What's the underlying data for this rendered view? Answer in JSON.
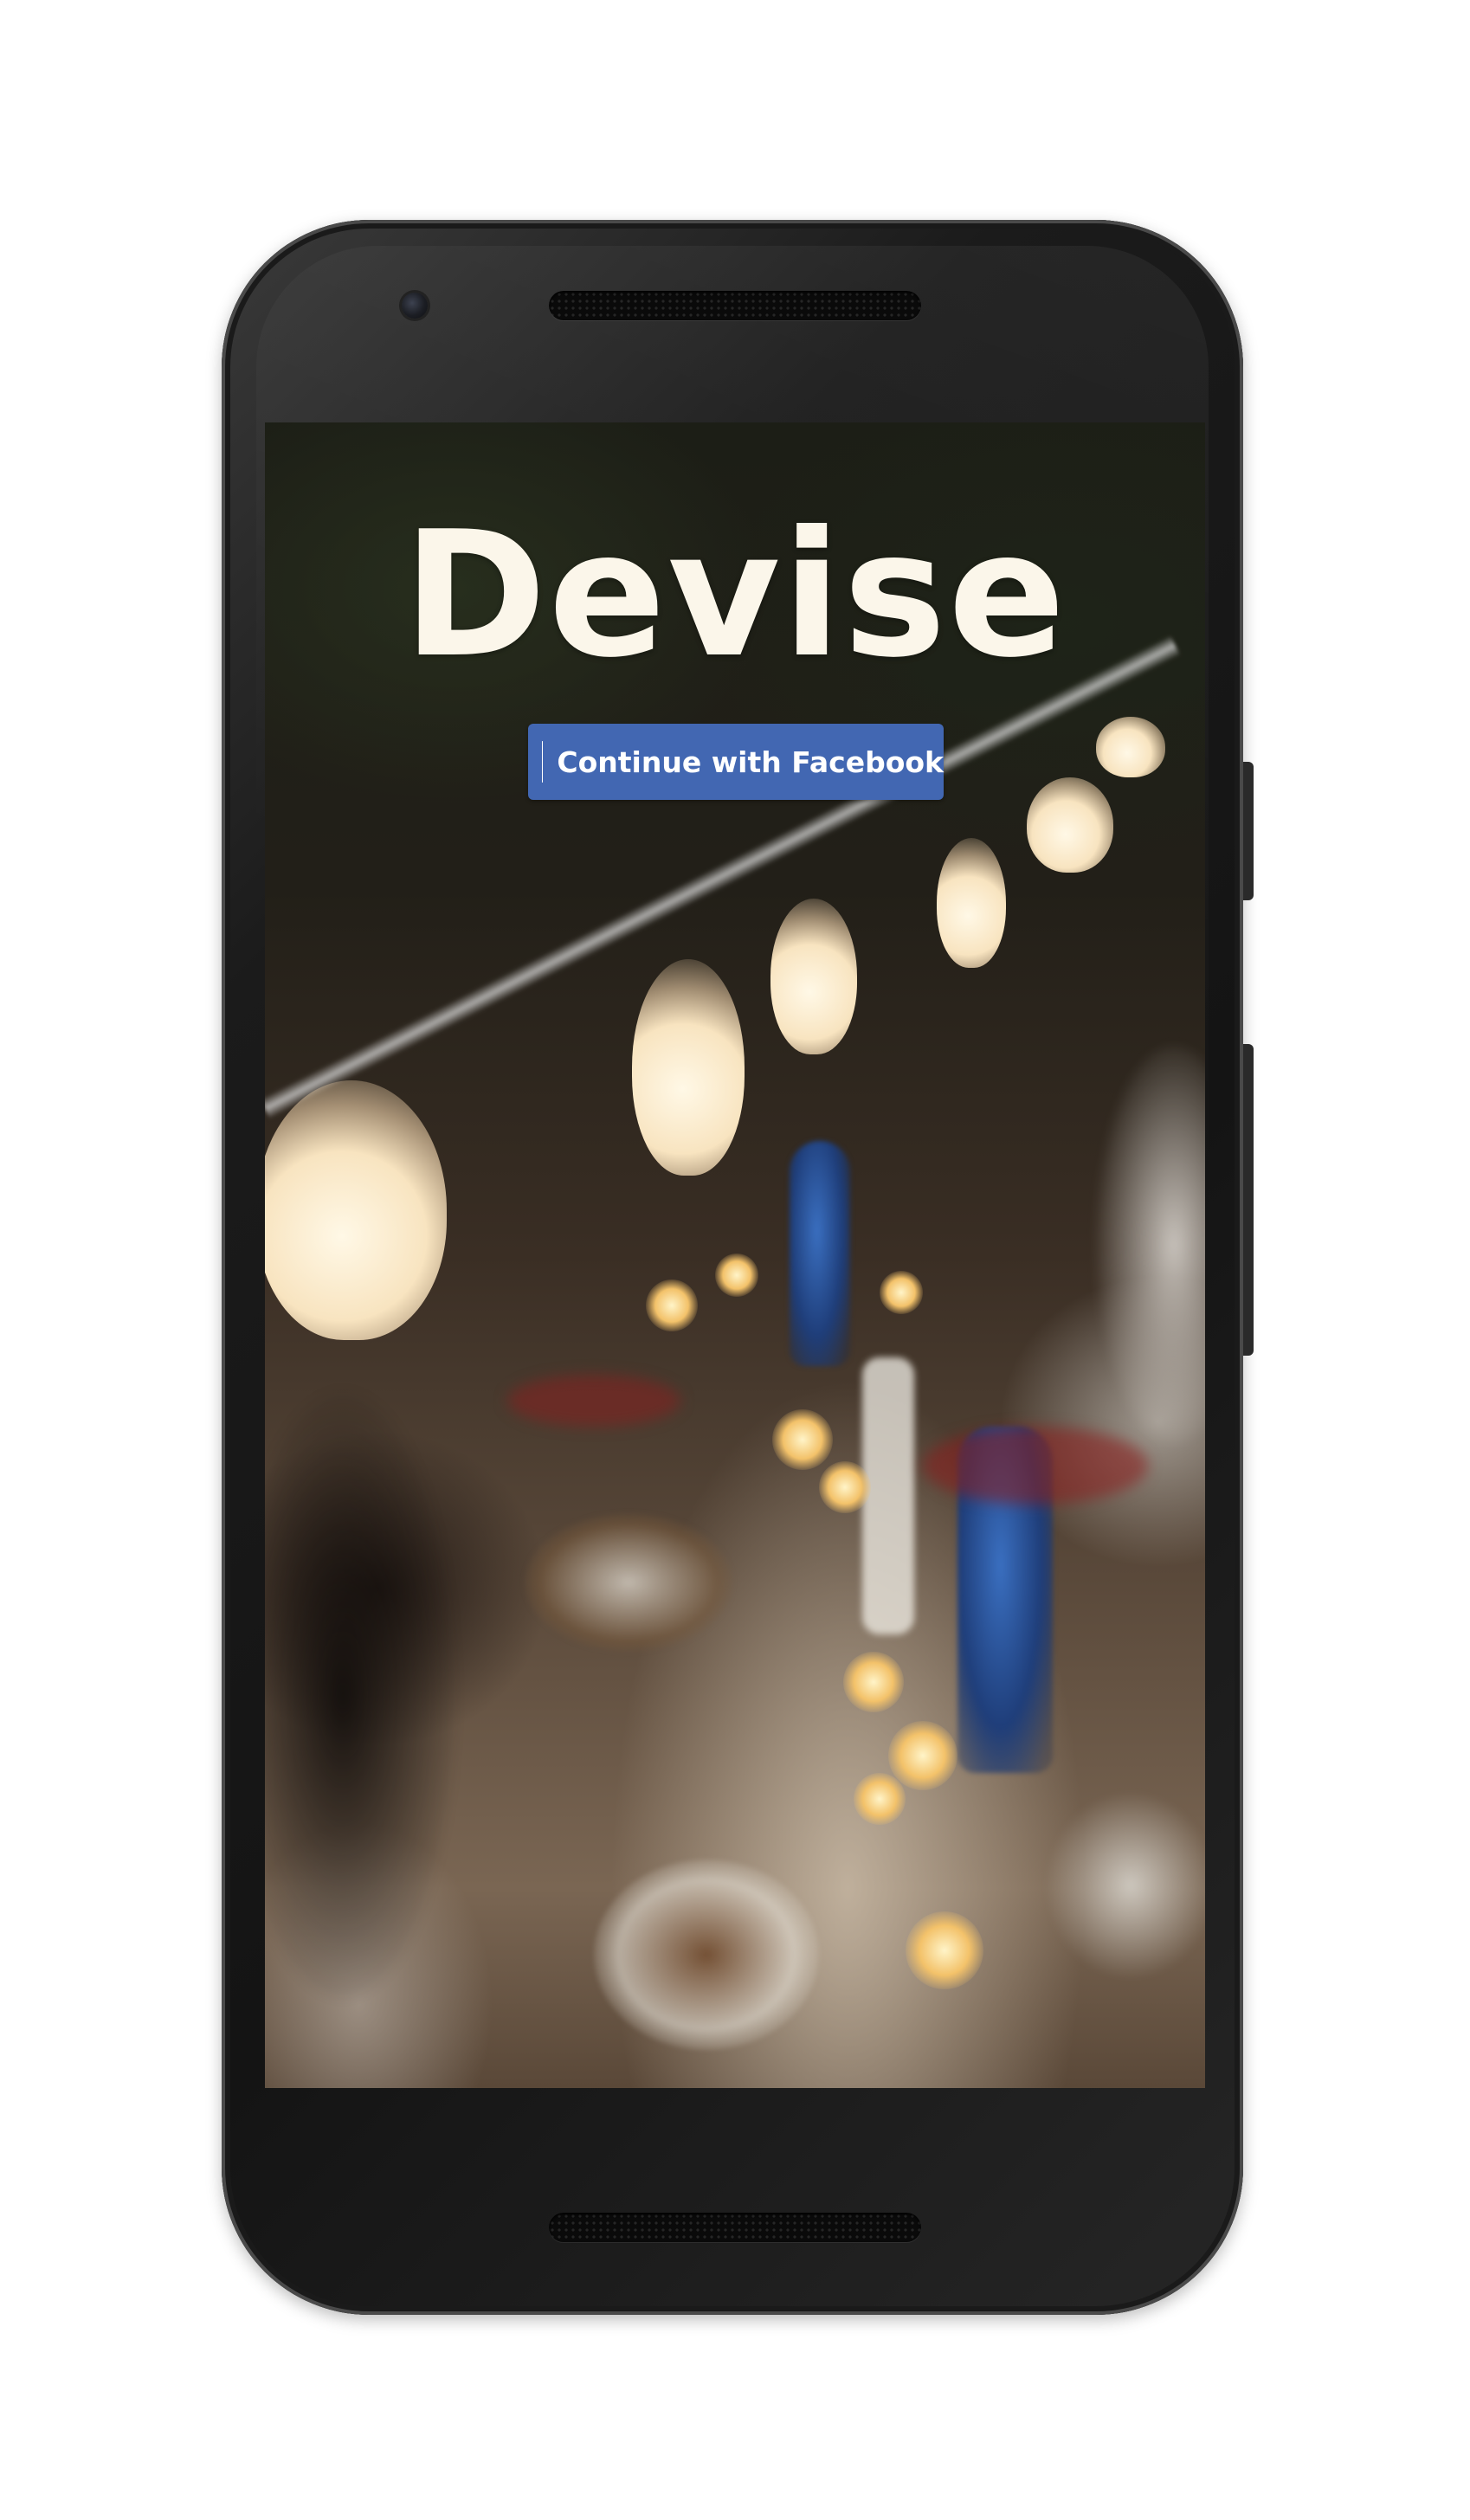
{
  "app": {
    "title": "Devise"
  },
  "login": {
    "facebook_button_label": "Continue with Facebook",
    "facebook_icon": "facebook-f-icon",
    "facebook_icon_glyph": "f",
    "facebook_color": "#4267b2"
  },
  "colors": {
    "title_text": "#fbf6ea",
    "device_frame": "#1b1b1b"
  }
}
